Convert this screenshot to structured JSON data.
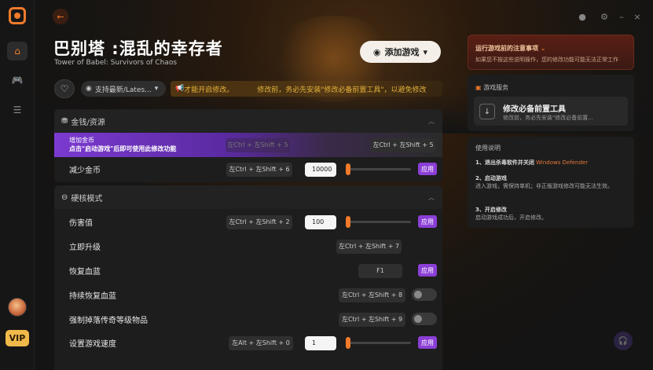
{
  "sidebar": {
    "vip_label": "VIP"
  },
  "header": {
    "title": "巴别塔 :混乱的幸存者",
    "subtitle": "Tower of Babel: Survivors of Chaos",
    "add_button": "添加游戏",
    "version_label": "支持最新/Lates...",
    "notice_1": "才能开启修改。",
    "notice_2": "修改前，务必先安装\"修改必备前置工具\"，以避免修改"
  },
  "sections": [
    {
      "title": "金钱/资源"
    },
    {
      "title": "硬核模式"
    }
  ],
  "rows": {
    "add_gold": {
      "label": "增加金币",
      "hint": "点击\"启动游戏\"后即可使用此修改功能",
      "hotkey_dim": "左Ctrl + 左Shift + 5",
      "hotkey": "左Ctrl + 左Shift + 5"
    },
    "reduce_gold": {
      "label": "减少金币",
      "hotkey": "左Ctrl + 左Shift + 6",
      "value": "10000",
      "apply": "应用"
    },
    "damage": {
      "label": "伤害值",
      "hotkey": "左Ctrl + 左Shift + 2",
      "value": "100",
      "apply": "应用"
    },
    "level_up": {
      "label": "立即升级",
      "hotkey": "左Ctrl + 左Shift + 7"
    },
    "restore_hp": {
      "label": "恢复血蓝",
      "hotkey": "F1",
      "apply": "应用"
    },
    "regen_hp": {
      "label": "持续恢复血蓝",
      "hotkey": "左Ctrl + 左Shift + 8"
    },
    "drop_legend": {
      "label": "强制掉落传奇等级物品",
      "hotkey": "左Ctrl + 左Shift + 9"
    },
    "game_speed": {
      "label": "设置游戏速度",
      "hotkey": "左Alt + 左Shift + 0",
      "value": "1",
      "apply": "应用"
    }
  },
  "right": {
    "warn_title": "运行游戏前的注意事项",
    "warn_text": "如果您不按这些说明操作，您的修改功能可能无法正常工作",
    "service_header": "游戏服务",
    "service_title": "修改必备前置工具",
    "service_sub": "修改前，务必先安装\"修改必备前置...",
    "instr_header": "使用说明",
    "instr_1_title": "1、退出杀毒软件并关闭",
    "instr_1_hl": "Windows Defender",
    "instr_2_title": "2、启动游戏",
    "instr_2_text": "进入游戏，需保持单机；非正版游戏修改可能无法生效。",
    "instr_3_title": "3、开启修改",
    "instr_3_text": "启动游戏成功后，开启修改。"
  },
  "colors": {
    "accent": "#f07a2a",
    "purple": "#8b3fd6",
    "notice": "#e3b23c"
  }
}
